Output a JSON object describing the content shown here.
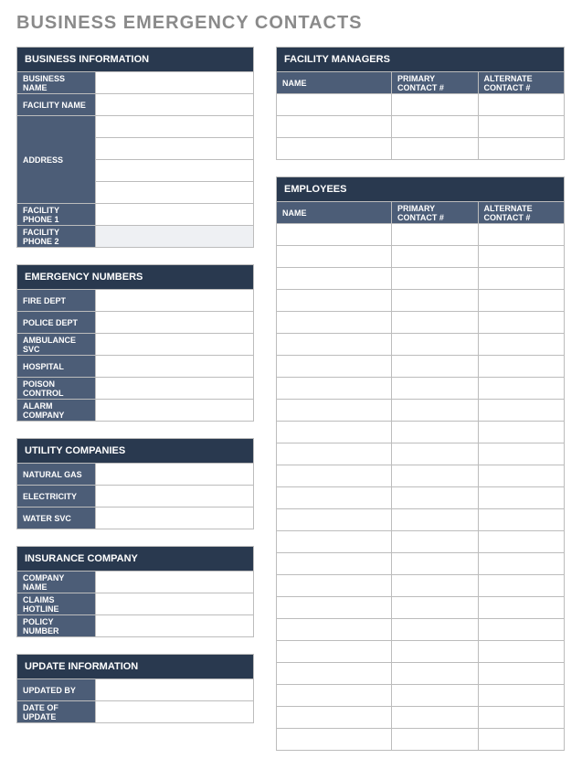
{
  "title": "BUSINESS EMERGENCY CONTACTS",
  "left": {
    "businessInfo": {
      "header": "BUSINESS INFORMATION",
      "rows": [
        {
          "label": "BUSINESS NAME",
          "value": ""
        },
        {
          "label": "FACILITY NAME",
          "value": ""
        },
        {
          "label": "ADDRESS",
          "value": "",
          "span": 4
        },
        {
          "label": "FACILITY PHONE 1",
          "value": ""
        },
        {
          "label": "FACILITY PHONE 2",
          "value": "",
          "shaded": true
        }
      ]
    },
    "emergencyNumbers": {
      "header": "EMERGENCY NUMBERS",
      "rows": [
        {
          "label": "FIRE DEPT",
          "value": ""
        },
        {
          "label": "POLICE DEPT",
          "value": ""
        },
        {
          "label": "AMBULANCE SVC",
          "value": ""
        },
        {
          "label": "HOSPITAL",
          "value": ""
        },
        {
          "label": "POISON CONTROL",
          "value": ""
        },
        {
          "label": "ALARM COMPANY",
          "value": ""
        }
      ]
    },
    "utilityCompanies": {
      "header": "UTILITY COMPANIES",
      "rows": [
        {
          "label": "NATURAL GAS",
          "value": ""
        },
        {
          "label": "ELECTRICITY",
          "value": ""
        },
        {
          "label": "WATER SVC",
          "value": ""
        }
      ]
    },
    "insurance": {
      "header": "INSURANCE COMPANY",
      "rows": [
        {
          "label": "COMPANY NAME",
          "value": ""
        },
        {
          "label": "CLAIMS HOTLINE",
          "value": ""
        },
        {
          "label": "POLICY NUMBER",
          "value": ""
        }
      ]
    },
    "updateInfo": {
      "header": "UPDATE INFORMATION",
      "rows": [
        {
          "label": "UPDATED BY",
          "value": ""
        },
        {
          "label": "DATE OF UPDATE",
          "value": ""
        }
      ]
    }
  },
  "right": {
    "facilityManagers": {
      "header": "FACILITY MANAGERS",
      "columns": [
        "NAME",
        "PRIMARY CONTACT #",
        "ALTERNATE CONTACT #"
      ],
      "rows": [
        [
          "",
          "",
          ""
        ],
        [
          "",
          "",
          ""
        ],
        [
          "",
          "",
          ""
        ]
      ]
    },
    "employees": {
      "header": "EMPLOYEES",
      "columns": [
        "NAME",
        "PRIMARY CONTACT #",
        "ALTERNATE CONTACT #"
      ],
      "rows": [
        [
          "",
          "",
          ""
        ],
        [
          "",
          "",
          ""
        ],
        [
          "",
          "",
          ""
        ],
        [
          "",
          "",
          ""
        ],
        [
          "",
          "",
          ""
        ],
        [
          "",
          "",
          ""
        ],
        [
          "",
          "",
          ""
        ],
        [
          "",
          "",
          ""
        ],
        [
          "",
          "",
          ""
        ],
        [
          "",
          "",
          ""
        ],
        [
          "",
          "",
          ""
        ],
        [
          "",
          "",
          ""
        ],
        [
          "",
          "",
          ""
        ],
        [
          "",
          "",
          ""
        ],
        [
          "",
          "",
          ""
        ],
        [
          "",
          "",
          ""
        ],
        [
          "",
          "",
          ""
        ],
        [
          "",
          "",
          ""
        ],
        [
          "",
          "",
          ""
        ],
        [
          "",
          "",
          ""
        ],
        [
          "",
          "",
          ""
        ],
        [
          "",
          "",
          ""
        ],
        [
          "",
          "",
          ""
        ],
        [
          "",
          "",
          ""
        ]
      ]
    }
  }
}
